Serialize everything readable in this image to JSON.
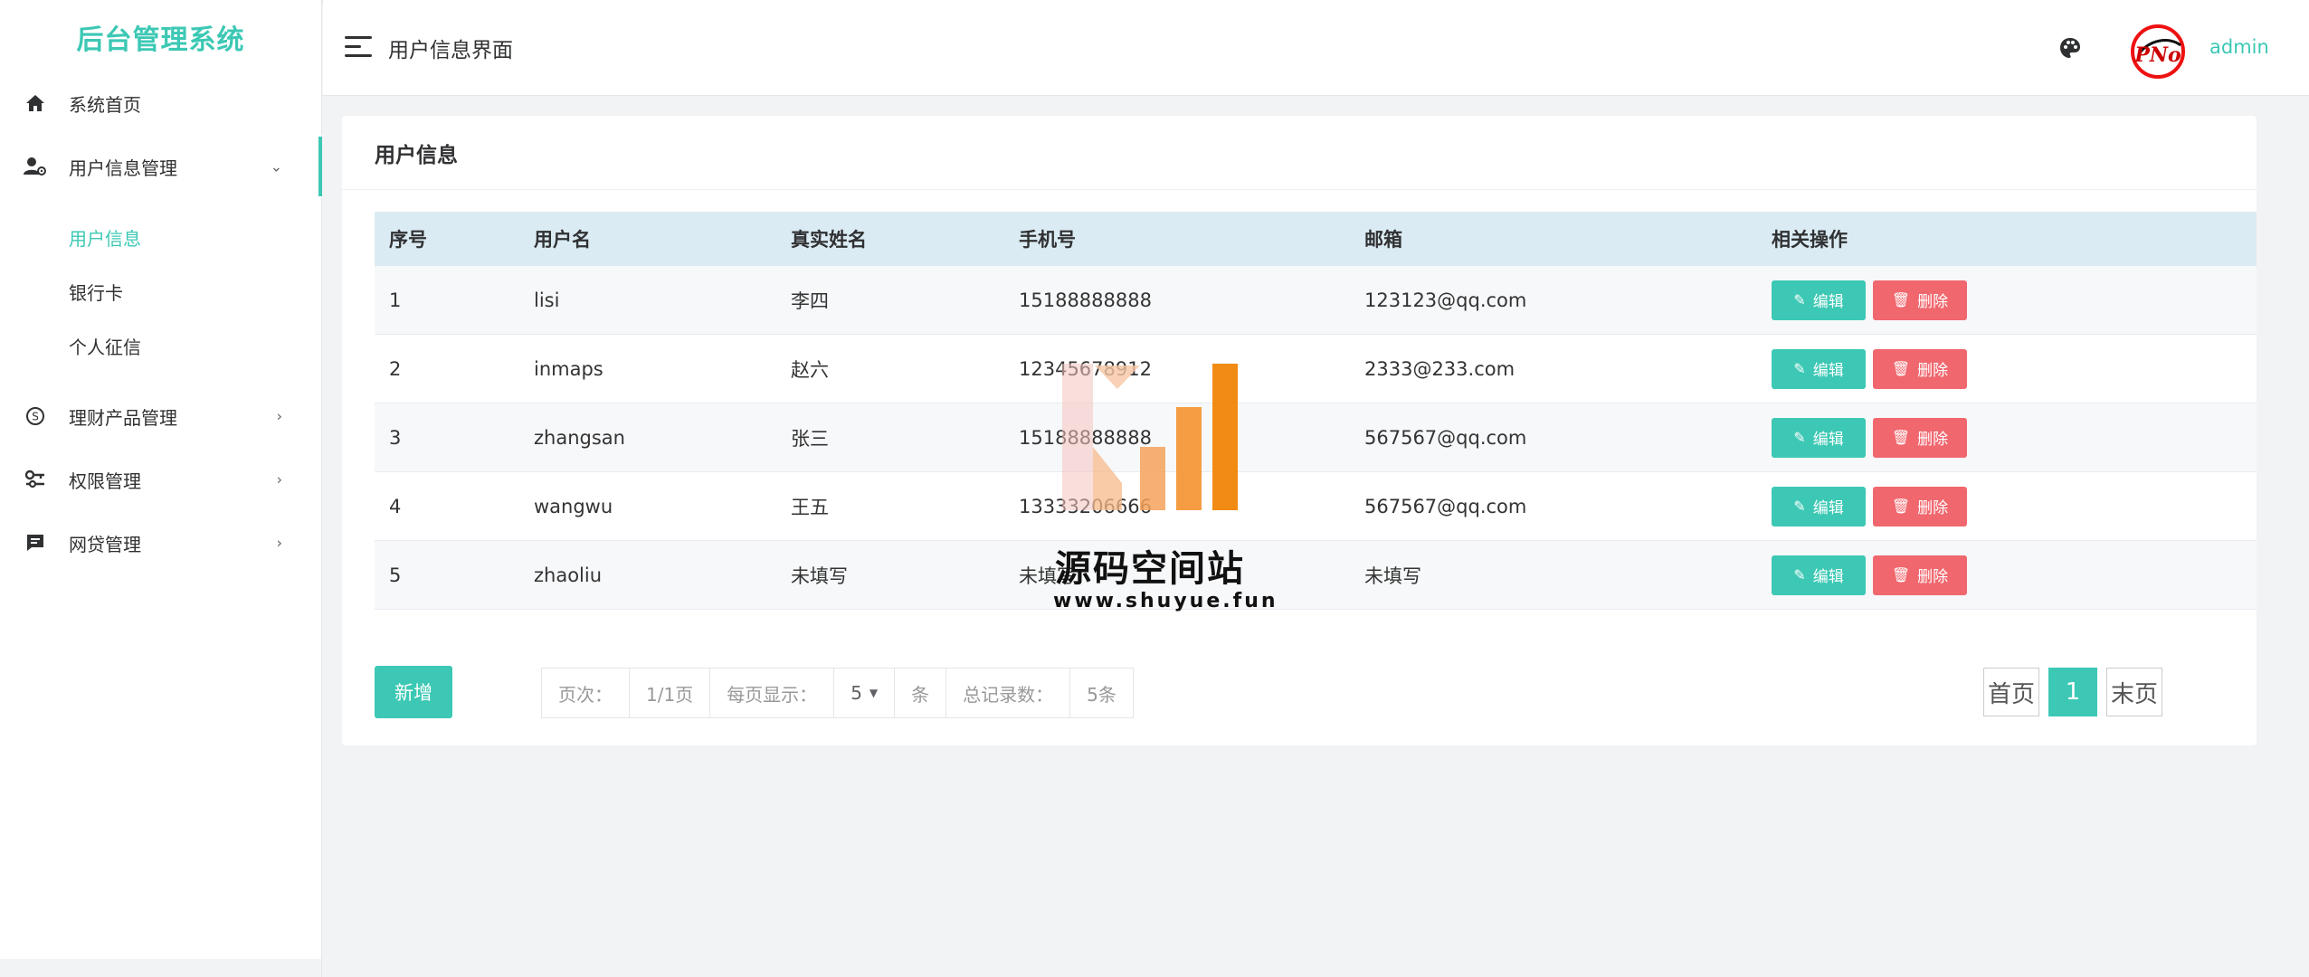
{
  "app": {
    "title": "后台管理系统"
  },
  "sidebar": {
    "items": [
      {
        "label": "系统首页",
        "icon": "home-icon"
      },
      {
        "label": "用户信息管理",
        "icon": "user-settings-icon",
        "expanded": true,
        "children": [
          {
            "label": "用户信息",
            "active": true
          },
          {
            "label": "银行卡"
          },
          {
            "label": "个人征信"
          }
        ]
      },
      {
        "label": "理财产品管理",
        "icon": "finance-icon"
      },
      {
        "label": "权限管理",
        "icon": "key-icon"
      },
      {
        "label": "网贷管理",
        "icon": "message-icon"
      }
    ]
  },
  "header": {
    "page_title": "用户信息界面",
    "username": "admin",
    "avatar_text": "PNo"
  },
  "card": {
    "title": "用户信息"
  },
  "table": {
    "columns": [
      "序号",
      "用户名",
      "真实姓名",
      "手机号",
      "邮箱",
      "相关操作"
    ],
    "rows": [
      {
        "id": "1",
        "username": "lisi",
        "realname": "李四",
        "phone": "15188888888",
        "email": "123123@qq.com"
      },
      {
        "id": "2",
        "username": "inmaps",
        "realname": "赵六",
        "phone": "12345678912",
        "email": "2333@233.com"
      },
      {
        "id": "3",
        "username": "zhangsan",
        "realname": "张三",
        "phone": "15188888888",
        "email": "567567@qq.com"
      },
      {
        "id": "4",
        "username": "wangwu",
        "realname": "王五",
        "phone": "13333206666",
        "email": "567567@qq.com"
      },
      {
        "id": "5",
        "username": "zhaoliu",
        "realname": "未填写",
        "phone": "未填写",
        "email": "未填写"
      }
    ],
    "edit_label": "编辑",
    "delete_label": "删除"
  },
  "footer": {
    "add_label": "新增",
    "page_label": "页次：",
    "page_value": "1/1页",
    "per_page_label": "每页显示：",
    "per_page_value": "5",
    "per_page_unit": "条",
    "total_label": "总记录数：",
    "total_value": "5条",
    "first_label": "首页",
    "current_page": "1",
    "last_label": "末页"
  },
  "watermark": {
    "text": "源码空间站",
    "url": "www.shuyue.fun"
  },
  "colors": {
    "accent": "#3cc8b4",
    "danger": "#f0676e",
    "table_header": "#dbebf3"
  }
}
